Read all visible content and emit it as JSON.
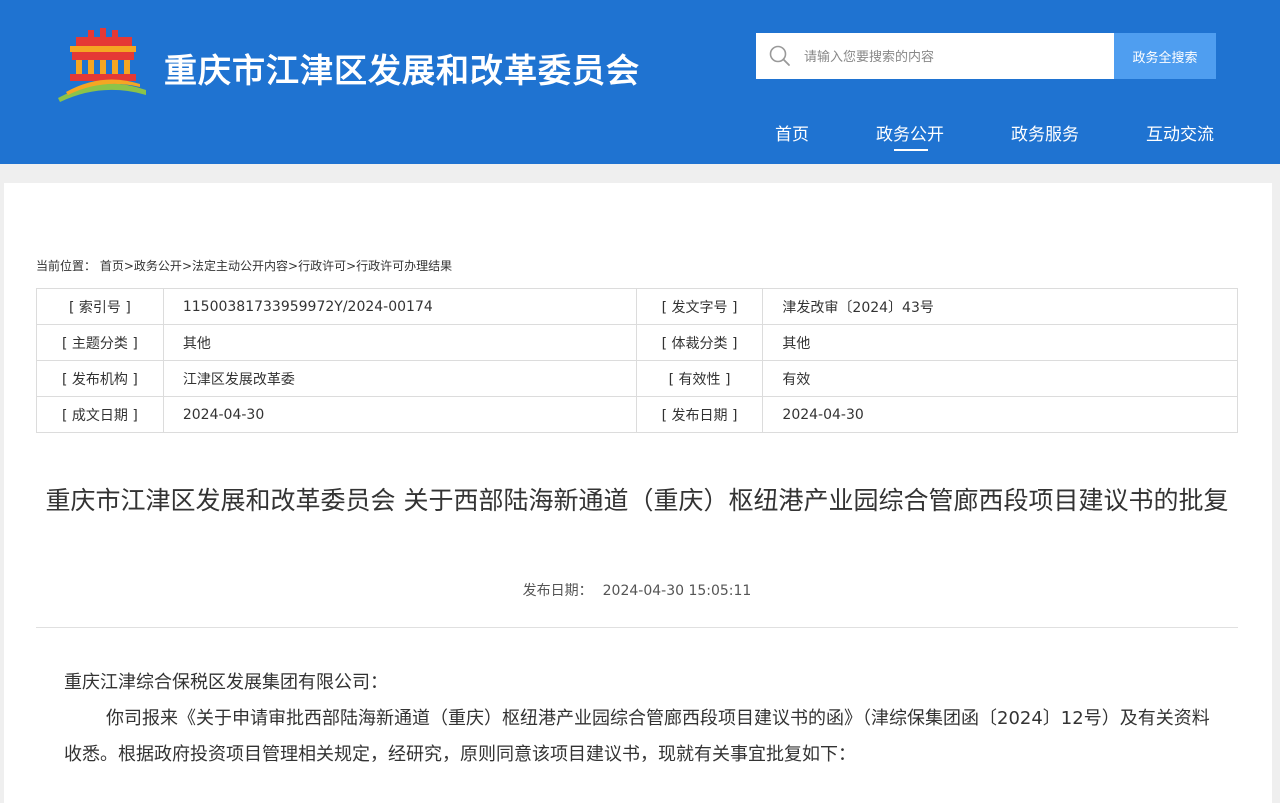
{
  "header": {
    "site_title": "重庆市江津区发展和改革委员会",
    "search_placeholder": "请输入您要搜索的内容",
    "search_button": "政务全搜索",
    "colors": {
      "header_bg": "#1f73d1",
      "search_button_bg": "#4f9ef0"
    }
  },
  "nav": {
    "items": [
      {
        "label": "首页"
      },
      {
        "label": "政务公开",
        "active": true
      },
      {
        "label": "政务服务"
      },
      {
        "label": "互动交流"
      }
    ]
  },
  "breadcrumb": {
    "prefix": "当前位置：",
    "items": [
      "首页",
      "政务公开",
      "法定主动公开内容",
      "行政许可",
      "行政许可办理结果"
    ],
    "separator": ">"
  },
  "meta": {
    "rows": [
      [
        {
          "label": "[ 索引号 ]",
          "value": "11500381733959972Y/2024-00174"
        },
        {
          "label": "[ 发文字号 ]",
          "value": "津发改审〔2024〕43号"
        }
      ],
      [
        {
          "label": "[ 主题分类 ]",
          "value": "其他"
        },
        {
          "label": "[ 体裁分类 ]",
          "value": "其他"
        }
      ],
      [
        {
          "label": "[ 发布机构 ]",
          "value": "江津区发展改革委"
        },
        {
          "label": "[ 有效性 ]",
          "value": "有效"
        }
      ],
      [
        {
          "label": "[ 成文日期 ]",
          "value": "2024-04-30"
        },
        {
          "label": "[ 发布日期 ]",
          "value": "2024-04-30"
        }
      ]
    ]
  },
  "document": {
    "title": "重庆市江津区发展和改革委员会 关于西部陆海新通道（重庆）枢纽港产业园综合管廊西段项目建议书的批复",
    "pub_label": "发布日期：",
    "pub_value": "2024-04-30 15:05:11",
    "paragraphs": [
      "重庆江津综合保税区发展集团有限公司：",
      "你司报来《关于申请审批西部陆海新通道（重庆）枢纽港产业园综合管廊西段项目建议书的函》（津综保集团函〔2024〕12号）及有关资料收悉。根据政府投资项目管理相关规定，经研究，原则同意该项目建议书，现就有关事宜批复如下："
    ]
  }
}
